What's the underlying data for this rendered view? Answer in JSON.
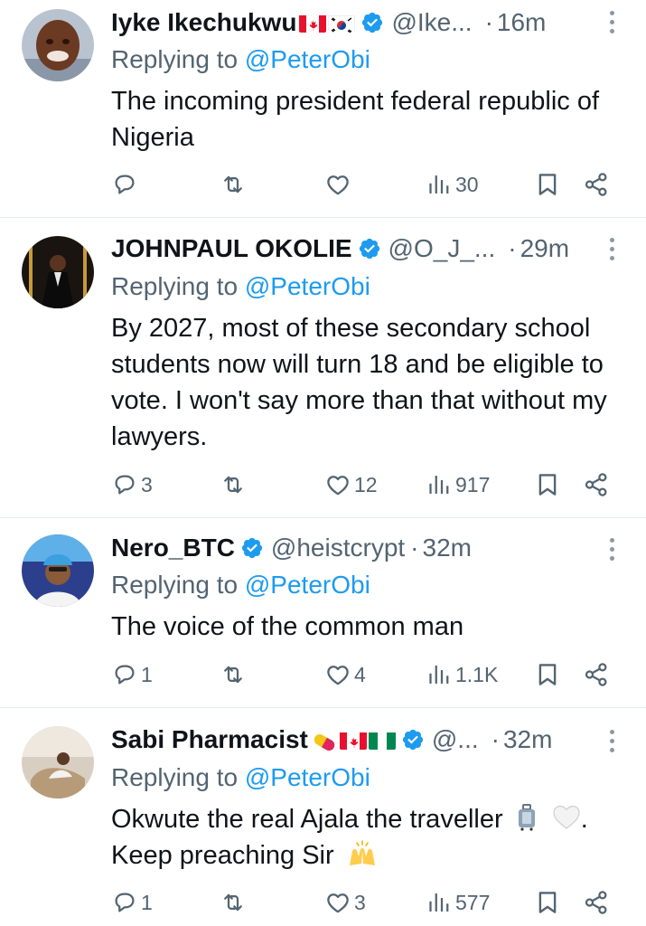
{
  "tweets": [
    {
      "name": "Iyke Ikechukwu",
      "handle": "@Ike...",
      "time": "16m",
      "reply_prefix": "Replying to ",
      "mention": "@PeterObi",
      "text": "The incoming president federal republic of Nigeria",
      "emojis": [
        "canada-flag",
        "south-korea-flag"
      ],
      "replies": "",
      "retweets": "",
      "likes": "",
      "views": "30"
    },
    {
      "name": "JOHNPAUL OKOLIE",
      "handle": "@O_J_...",
      "time": "29m",
      "reply_prefix": "Replying to ",
      "mention": "@PeterObi",
      "text": "By 2027, most of these secondary school students now will turn 18 and be eligible to vote. I won't say more than that without my lawyers.",
      "emojis": [],
      "replies": "3",
      "retweets": "",
      "likes": "12",
      "views": "917"
    },
    {
      "name": "Nero_BTC",
      "handle": "@heistcrypt",
      "time": "32m",
      "reply_prefix": "Replying to ",
      "mention": "@PeterObi",
      "text": "The voice of the common man",
      "emojis": [],
      "replies": "1",
      "retweets": "",
      "likes": "4",
      "views": "1.1K"
    },
    {
      "name": "Sabi Pharmacist",
      "handle": "@...",
      "time": "32m",
      "reply_prefix": "Replying to ",
      "mention": "@PeterObi",
      "text_line1": "Okwute the real Ajala the traveller",
      "text_line1_end": ".",
      "text_line2": "Keep preaching Sir",
      "emojis": [
        "pill",
        "canada-flag",
        "nigeria-flag"
      ],
      "text_emojis": [
        "luggage",
        "white-heart",
        "raising-hands"
      ],
      "replies": "1",
      "retweets": "",
      "likes": "3",
      "views": "577"
    }
  ],
  "separator": "·",
  "icons": {
    "verified": "verified-badge-icon",
    "reply": "reply-icon",
    "retweet": "retweet-icon",
    "like": "heart-icon",
    "views": "views-icon",
    "bookmark": "bookmark-icon",
    "share": "share-icon",
    "more": "more-vertical-icon"
  },
  "colors": {
    "verified": "#1d9bf0",
    "mention": "#1d9bf0",
    "secondary_text": "#536471",
    "primary_text": "#0f1419",
    "divider": "#e6ecf0"
  }
}
